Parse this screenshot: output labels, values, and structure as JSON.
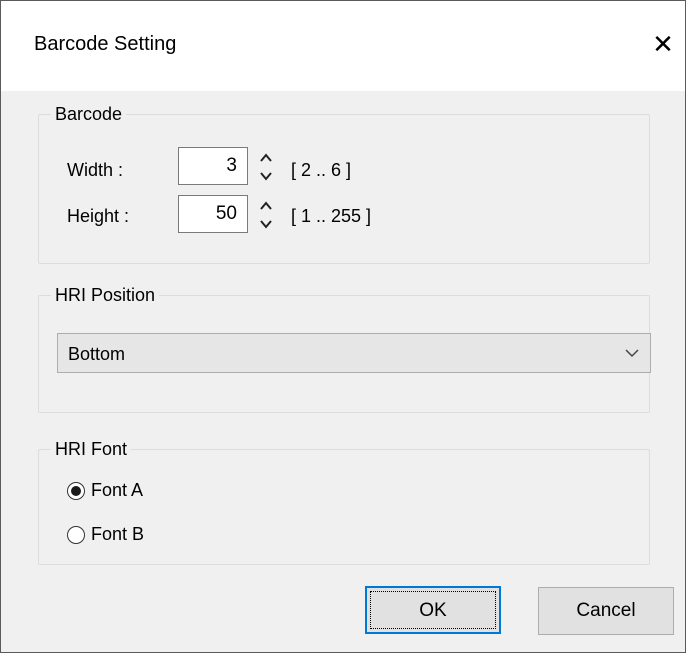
{
  "dialog": {
    "title": "Barcode Setting",
    "close_glyph": "✕"
  },
  "barcode": {
    "legend": "Barcode",
    "width_label": "Width :",
    "width_value": "3",
    "width_range": "[ 2 .. 6 ]",
    "height_label": "Height :",
    "height_value": "50",
    "height_range": "[ 1 .. 255 ]"
  },
  "hri_position": {
    "legend": "HRI Position",
    "selected": "Bottom"
  },
  "hri_font": {
    "legend": "HRI Font",
    "options": [
      {
        "label": "Font A",
        "checked": true
      },
      {
        "label": "Font B",
        "checked": false
      }
    ]
  },
  "buttons": {
    "ok": "OK",
    "cancel": "Cancel"
  },
  "colors": {
    "focus_border": "#0078d7",
    "title_bg": "#ffffff",
    "dialog_bg": "#f0f0f0"
  }
}
